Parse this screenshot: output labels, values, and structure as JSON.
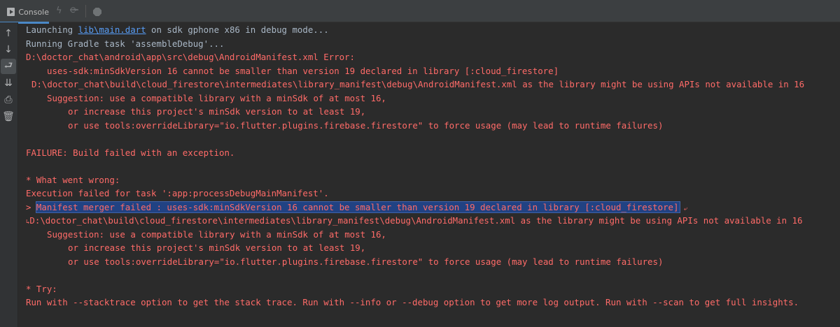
{
  "tab": {
    "label": "Console"
  },
  "toolbar_icons": [
    "lightning-icon",
    "reload-icon",
    "stop-icon"
  ],
  "sidebar_icons": [
    "arrow-up-icon",
    "arrow-down-icon",
    "soft-wrap-icon",
    "scroll-to-end-icon",
    "print-icon",
    "trash-icon"
  ],
  "console": {
    "launch_prefix": "Launching ",
    "launch_link": "lib\\main.dart",
    "launch_suffix": " on sdk gphone x86 in debug mode...",
    "gradle": "Running Gradle task 'assembleDebug'...",
    "manifest_error": "D:\\doctor_chat\\android\\app\\src\\debug\\AndroidManifest.xml Error:",
    "uses_sdk": "uses-sdk:minSdkVersion 16 cannot be smaller than version 19 declared in library [:cloud_firestore]",
    "lib_manifest": "D:\\doctor_chat\\build\\cloud_firestore\\intermediates\\library_manifest\\debug\\AndroidManifest.xml as the library might be using APIs not available in 16",
    "suggestion": "Suggestion: use a compatible library with a minSdk of at most 16,",
    "increase": "or increase this project's minSdk version to at least 19,",
    "override": "or use tools:overrideLibrary=\"io.flutter.plugins.firebase.firestore\" to force usage (may lead to runtime failures)",
    "failure": "FAILURE: Build failed with an exception.",
    "what_wrong": "* What went wrong:",
    "exec_failed": "Execution failed for task ':app:processDebugMainManifest'.",
    "merger_prefix": "> ",
    "merger_selected": "Manifest merger failed : uses-sdk:minSdkVersion 16 cannot be smaller than version 19 declared in library [:cloud_firestore]",
    "try": "* Try:",
    "run_with": "Run with --stacktrace option to get the stack trace. Run with --info or --debug option to get more log output. Run with --scan to get full insights."
  },
  "colors": {
    "background": "#2b2b2b",
    "error_text": "#ff6b68",
    "normal_text": "#a9b7c6",
    "link": "#589df6",
    "selection": "#214283"
  }
}
